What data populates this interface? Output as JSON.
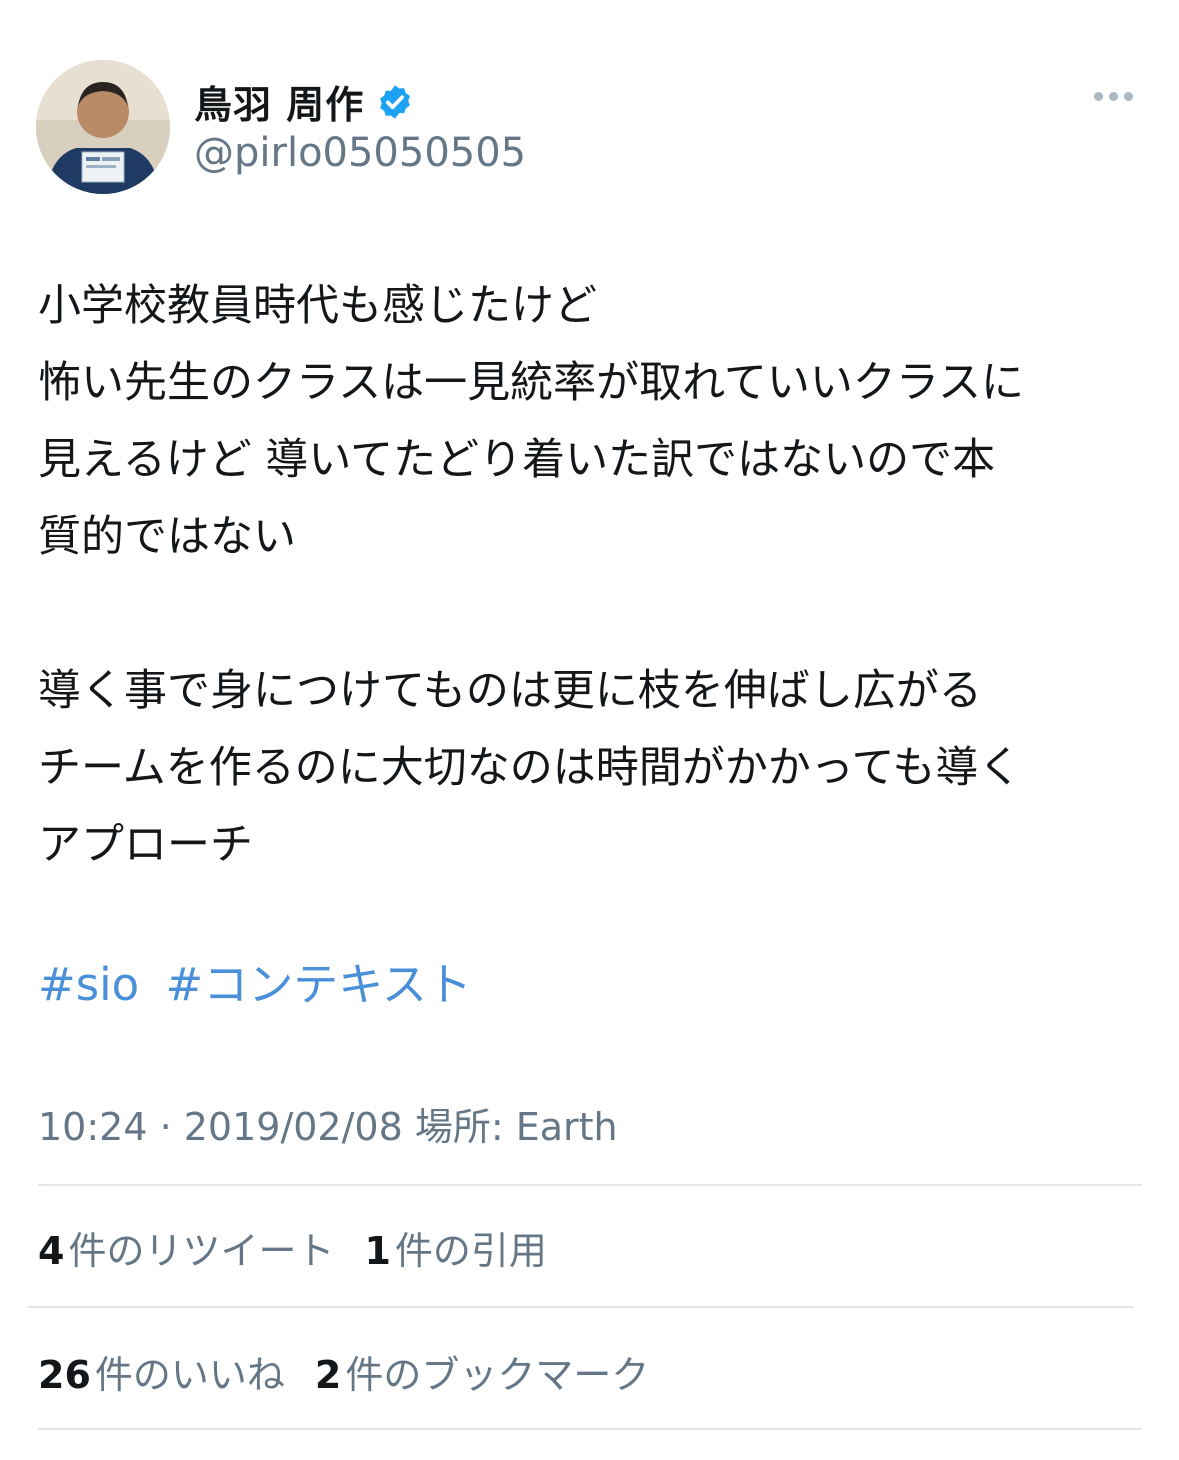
{
  "author": {
    "name": "鳥羽 周作",
    "handle": "@pirlo05050505",
    "verified": true,
    "avatar_icon": "profile-photo"
  },
  "tweet": {
    "text": "小学校教員時代も感じたけど\n怖い先生のクラスは一見統率が取れていいクラスに\n見えるけど 導いてたどり着いた訳ではないので本\n質的ではない\n\n導く事で身につけてものは更に枝を伸ばし広がる\nチームを作るのに大切なのは時間がかかっても導く\nアプローチ",
    "hashtags": [
      "#sio",
      "#コンテキスト"
    ],
    "meta": "10:24 · 2019/02/08 場所: Earth"
  },
  "stats": {
    "retweets_count": "4",
    "retweets_label": "件のリツイート",
    "quotes_count": "1",
    "quotes_label": "件の引用",
    "likes_count": "26",
    "likes_label": "件のいいね",
    "bookmarks_count": "2",
    "bookmarks_label": "件のブックマーク"
  },
  "colors": {
    "hashtag": "#4a90d9",
    "verified": "#1da1f2",
    "secondary_text": "#657786"
  }
}
